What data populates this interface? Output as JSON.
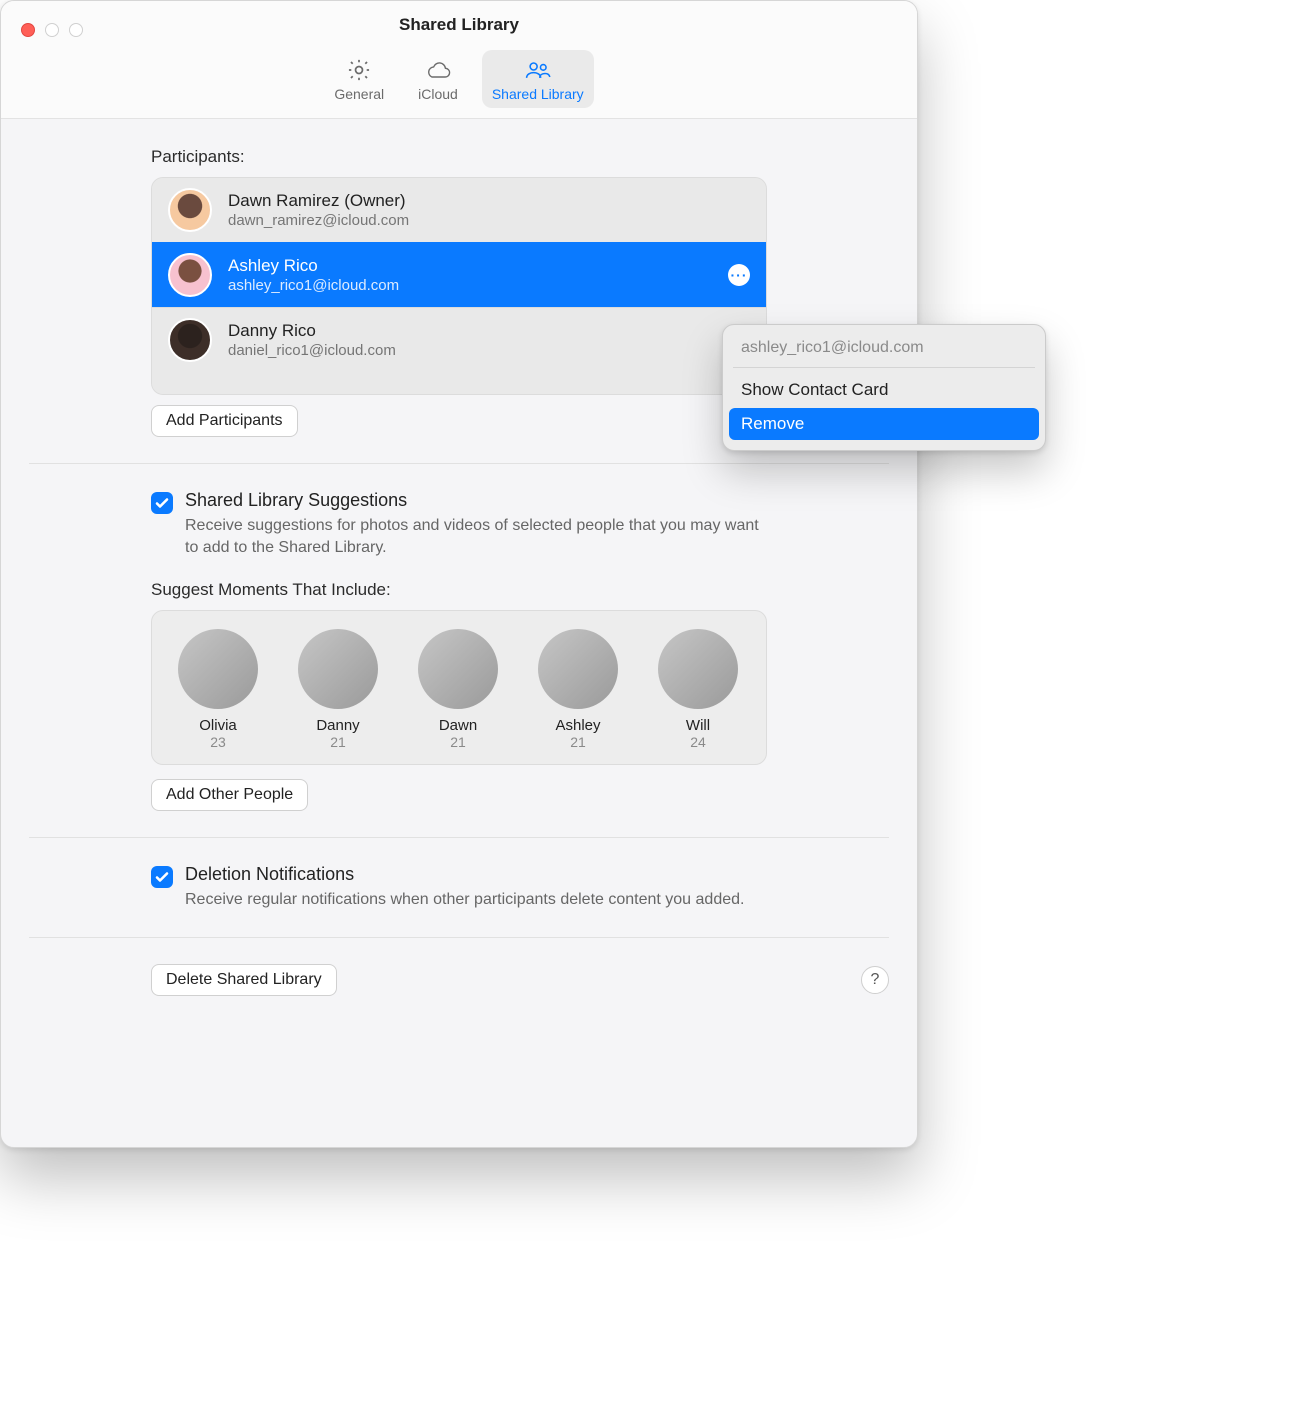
{
  "window": {
    "title": "Shared Library"
  },
  "tabs": [
    {
      "label": "General"
    },
    {
      "label": "iCloud"
    },
    {
      "label": "Shared Library"
    }
  ],
  "participants": {
    "label": "Participants:",
    "rows": [
      {
        "name": "Dawn Ramirez (Owner)",
        "email": "dawn_ramirez@icloud.com"
      },
      {
        "name": "Ashley Rico",
        "email": "ashley_rico1@icloud.com"
      },
      {
        "name": "Danny Rico",
        "email": "daniel_rico1@icloud.com"
      }
    ],
    "addBtn": "Add Participants"
  },
  "popover": {
    "email": "ashley_rico1@icloud.com",
    "showCard": "Show Contact Card",
    "remove": "Remove"
  },
  "suggestions": {
    "title": "Shared Library Suggestions",
    "desc": "Receive suggestions for photos and videos of selected people that you may want to add to the Shared Library.",
    "sub": "Suggest Moments That Include:",
    "people": [
      {
        "name": "Olivia",
        "count": "23"
      },
      {
        "name": "Danny",
        "count": "21"
      },
      {
        "name": "Dawn",
        "count": "21"
      },
      {
        "name": "Ashley",
        "count": "21"
      },
      {
        "name": "Will",
        "count": "24"
      }
    ],
    "addOther": "Add Other People"
  },
  "deletion": {
    "title": "Deletion Notifications",
    "desc": "Receive regular notifications when other participants delete content you added."
  },
  "footer": {
    "deleteBtn": "Delete Shared Library",
    "help": "?"
  }
}
